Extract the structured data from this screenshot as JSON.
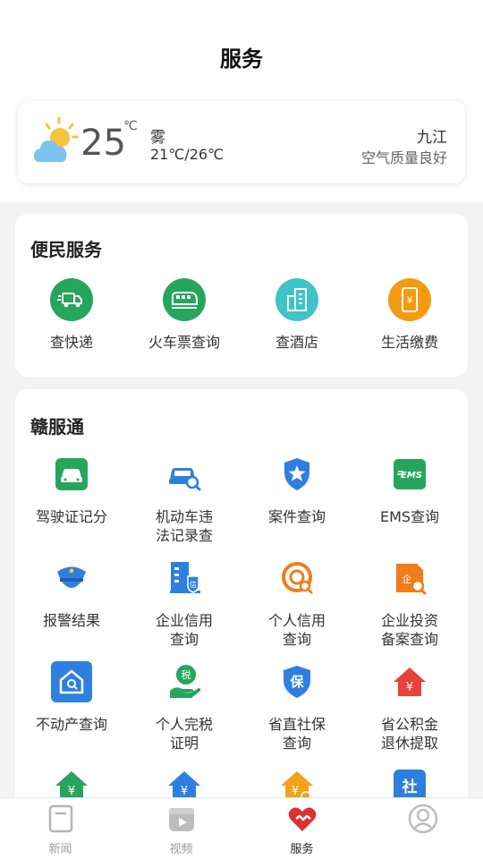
{
  "header": {
    "title": "服务"
  },
  "weather": {
    "temperature": "25",
    "unit": "℃",
    "condition": "雾",
    "range": "21℃/26℃",
    "city": "九江",
    "air_quality": "空气质量良好"
  },
  "convenience": {
    "title": "便民服务",
    "items": [
      {
        "label": "查快递",
        "icon": "truck-icon",
        "color": "#27a55c"
      },
      {
        "label": "火车票查询",
        "icon": "train-icon",
        "color": "#27a55c"
      },
      {
        "label": "查酒店",
        "icon": "hotel-icon",
        "color": "#3ec4c7"
      },
      {
        "label": "生活缴费",
        "icon": "phone-bill-icon",
        "color": "#f39a12"
      }
    ]
  },
  "ganfutong": {
    "title": "赣服通",
    "items": [
      {
        "label": "驾驶证记分",
        "icon": "car-icon"
      },
      {
        "label": "机动车违法记录查",
        "icon": "car-search-icon"
      },
      {
        "label": "案件查询",
        "icon": "police-badge-icon"
      },
      {
        "label": "EMS查询",
        "icon": "ems-icon"
      },
      {
        "label": "报警结果",
        "icon": "police-cap-icon"
      },
      {
        "label": "企业信用查询",
        "icon": "company-credit-icon"
      },
      {
        "label": "个人信用查询",
        "icon": "personal-credit-icon"
      },
      {
        "label": "企业投资备案查询",
        "icon": "investment-icon"
      },
      {
        "label": "不动产查询",
        "icon": "house-search-icon"
      },
      {
        "label": "个人完税证明",
        "icon": "tax-icon"
      },
      {
        "label": "省直社保查询",
        "icon": "social-security-icon"
      },
      {
        "label": "省公积金退休提取",
        "icon": "housing-fund-icon"
      }
    ],
    "labels_line1": [
      "驾驶证记分",
      "机动车违",
      "案件查询",
      "EMS查询",
      "报警结果",
      "企业信用",
      "个人信用",
      "企业投资",
      "不动产查询",
      "个人完税",
      "省直社保",
      "省公积金"
    ],
    "labels_line2": [
      "",
      "法记录查",
      "",
      "",
      "",
      "查询",
      "查询",
      "备案查询",
      "",
      "证明",
      "查询",
      "退休提取"
    ],
    "colors": {
      "green": "#27a55c",
      "blue": "#2e7fe0",
      "orange": "#f07d1a",
      "red": "#e8423a"
    }
  },
  "tabbar": {
    "items": [
      {
        "label": "新闻",
        "icon": "news-icon",
        "active": false
      },
      {
        "label": "视频",
        "icon": "video-icon",
        "active": false
      },
      {
        "label": "服务",
        "icon": "service-heart-icon",
        "active": true
      },
      {
        "label": "",
        "icon": "user-avatar-icon",
        "active": false
      }
    ]
  }
}
